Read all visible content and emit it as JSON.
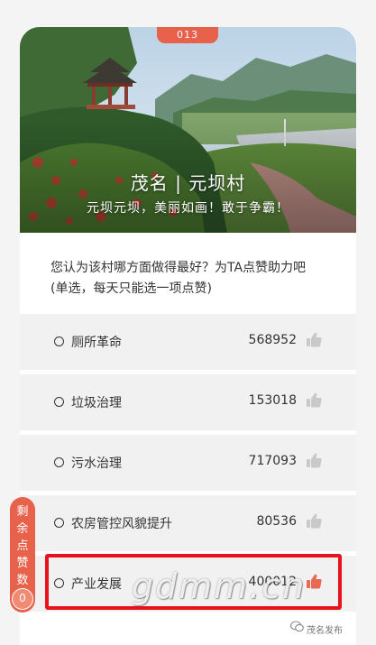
{
  "badge": "013",
  "hero": {
    "title": "茂名 | 元坝村",
    "subtitle": "元坝元坝，美丽如画！敢于争霸！"
  },
  "question": {
    "line1": "您认为该村哪方面做得最好？为TA点赞助力吧",
    "line2": "(单选，每天只能选一项点赞)"
  },
  "options": [
    {
      "label": "厕所革命",
      "count": "568952"
    },
    {
      "label": "垃圾治理",
      "count": "153018"
    },
    {
      "label": "污水治理",
      "count": "717093"
    },
    {
      "label": "农房管控风貌提升",
      "count": "80536"
    },
    {
      "label": "产业发展",
      "count": "400012"
    }
  ],
  "remaining": {
    "chars": [
      "剩",
      "余",
      "点",
      "赞",
      "数"
    ],
    "count": "0"
  },
  "watermark": "gdmm.cn",
  "source": "茂名发布",
  "colors": {
    "accent": "#e8614a",
    "highlight": "#e8131c",
    "option_bg": "#f1f1f1"
  },
  "icons": {
    "like": "thumbs-up-icon",
    "radio": "radio-circle-icon",
    "wechat": "wechat-icon"
  }
}
